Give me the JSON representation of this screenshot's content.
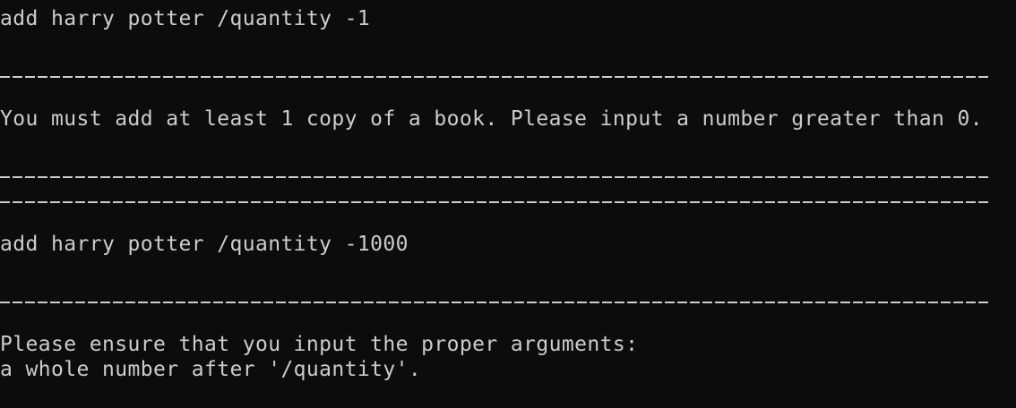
{
  "terminal": {
    "command_1": "add harry potter /quantity -1",
    "error_1": "You must add at least 1 copy of a book. Please input a number greater than 0.",
    "command_2": "add harry potter /quantity -1000",
    "error_2_line_1": "Please ensure that you input the proper arguments:",
    "error_2_line_2": "a whole number after '/quantity'."
  },
  "colors": {
    "background": "#0c0c0c",
    "text": "#cccccc"
  }
}
